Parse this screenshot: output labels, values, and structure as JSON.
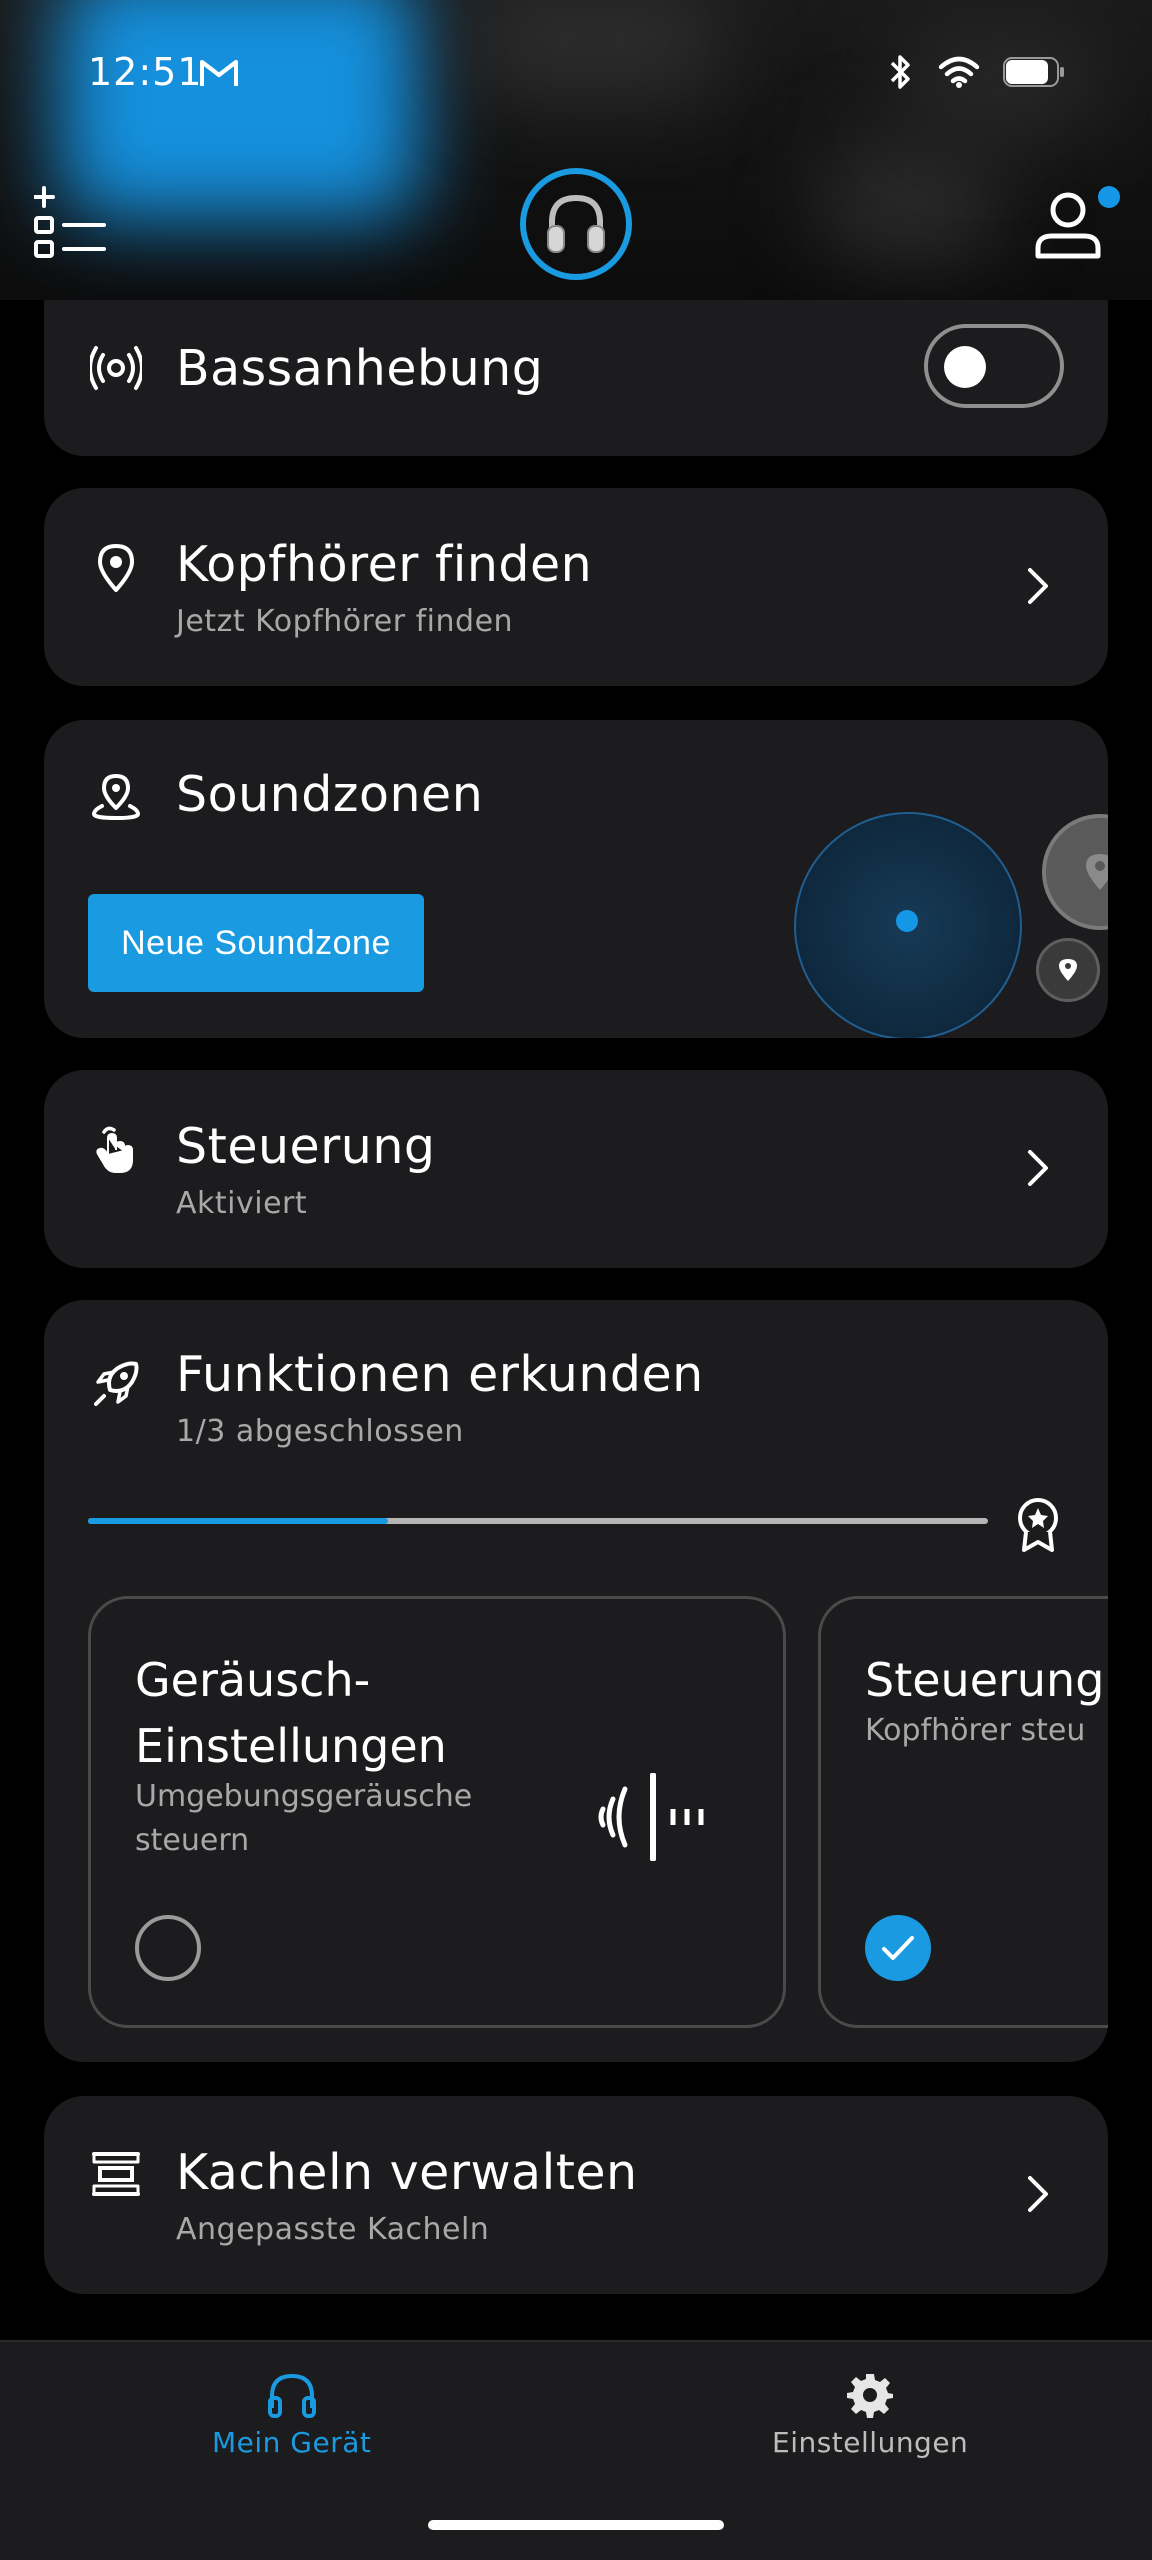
{
  "status_bar": {
    "time": "12:51",
    "icons": [
      "gmail-icon",
      "bluetooth-icon",
      "wifi-icon",
      "battery-icon"
    ]
  },
  "header": {
    "left_icon": "add-tile-list-icon",
    "center_icon": "headphones-avatar-icon",
    "right_icon": "user-profile-icon"
  },
  "cards": {
    "bass": {
      "title": "Bassanhebung",
      "toggle_on": false
    },
    "find": {
      "title": "Kopfhörer finden",
      "subtitle": "Jetzt Kopfhörer finden"
    },
    "soundzones": {
      "title": "Soundzonen",
      "button_label": "Neue Soundzone"
    },
    "control": {
      "title": "Steuerung",
      "subtitle": "Aktiviert"
    },
    "explore": {
      "title": "Funktionen erkunden",
      "subtitle": "1/3 abgeschlossen",
      "progress_fraction": 0.333,
      "features": [
        {
          "title_line1": "Geräusch-",
          "title_line2": "Einstellungen",
          "sub_line1": "Umgebungsgeräusche",
          "sub_line2": "steuern",
          "completed": false
        },
        {
          "title_line1": "Steuerung",
          "sub_line1": "Kopfhörer steu",
          "completed": true
        }
      ]
    },
    "tiles": {
      "title": "Kacheln verwalten",
      "subtitle": "Angepasste Kacheln"
    }
  },
  "bottom_nav": {
    "items": [
      {
        "label": "Mein Gerät",
        "active": true,
        "icon": "headphones-icon"
      },
      {
        "label": "Einstellungen",
        "active": false,
        "icon": "gear-icon"
      }
    ]
  },
  "colors": {
    "accent": "#1a9ae0",
    "card_bg": "#1c1c1e",
    "secondary_text": "#a8a8a8"
  }
}
